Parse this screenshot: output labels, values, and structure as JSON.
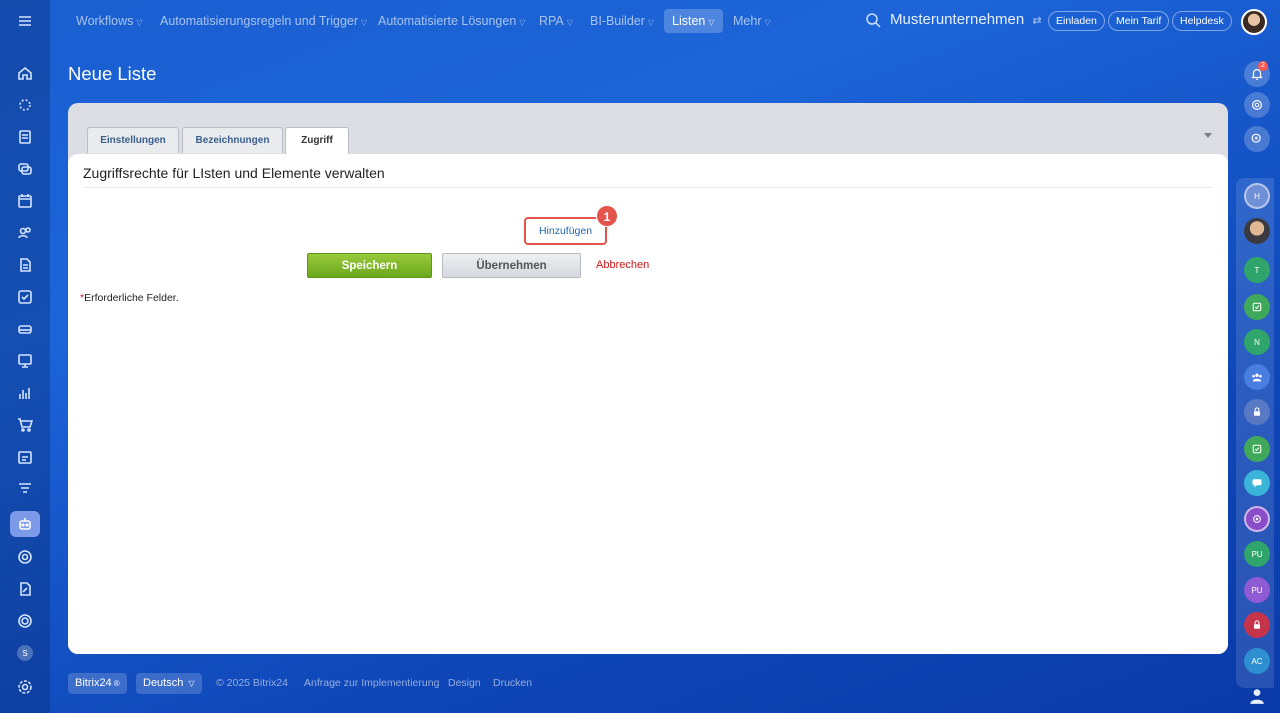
{
  "topnav": {
    "items": [
      {
        "label": "Workflows"
      },
      {
        "label": "Automatisierungsregeln und Trigger"
      },
      {
        "label": "Automatisierte Lösungen"
      },
      {
        "label": "RPA"
      },
      {
        "label": "BI-Builder"
      },
      {
        "label": "Listen"
      },
      {
        "label": "Mehr"
      }
    ],
    "company": "Musterunternehmen",
    "invite": "Einladen",
    "tariff": "Mein Tarif",
    "helpdesk": "Helpdesk"
  },
  "page": {
    "title": "Neue Liste"
  },
  "tabs": [
    {
      "label": "Einstellungen"
    },
    {
      "label": "Bezeichnungen"
    },
    {
      "label": "Zugriff"
    }
  ],
  "content": {
    "title": "Zugriffsrechte für LIsten und Elemente verwalten",
    "add_link": "Hinzufügen",
    "marker": "1",
    "save": "Speichern",
    "apply": "Übernehmen",
    "cancel": "Abbrechen",
    "required_star": "*",
    "required_text": "Erforderliche Felder."
  },
  "right_sidebar": {
    "bell_badge": "2",
    "avatars": [
      "H",
      "T",
      "N",
      "PU",
      "PU",
      "AC"
    ]
  },
  "left_sidebar": {
    "letter": "S"
  },
  "footer": {
    "brand": "Bitrix24",
    "language": "Deutsch",
    "copyright": "© 2025 Bitrix24",
    "implementation": "Anfrage zur Implementierung",
    "design": "Design",
    "print": "Drucken"
  },
  "colors": {
    "accent_green": "#7ab52a",
    "marker_red": "#e4544d",
    "cancel_red": "#d0171b",
    "link_blue": "#2067b0"
  }
}
